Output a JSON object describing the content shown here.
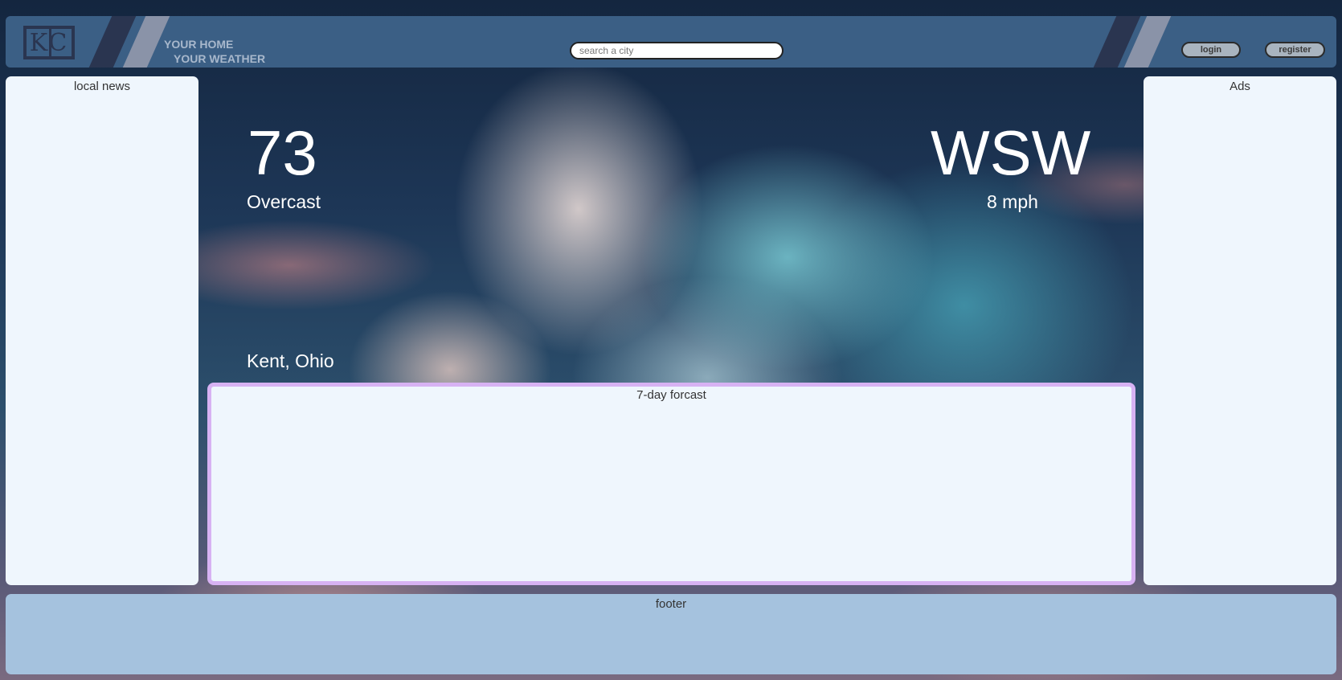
{
  "header": {
    "logo_text": "KC",
    "tagline_line1": "YOUR HOME",
    "tagline_line2": "YOUR WEATHER",
    "search_placeholder": "search a city",
    "login_label": "login",
    "register_label": "register"
  },
  "left_panel": {
    "title": "local news"
  },
  "right_panel": {
    "title": "Ads"
  },
  "weather": {
    "temperature": "73",
    "condition": "Overcast",
    "wind_direction": "WSW",
    "wind_speed": "8 mph",
    "location": "Kent, Ohio"
  },
  "forecast": {
    "title": "7-day forcast"
  },
  "footer": {
    "label": "footer"
  },
  "colors": {
    "header_bg": "#3b5f85",
    "panel_bg": "#eff6fd",
    "forecast_border": "#d7b2f3",
    "footer_bg": "#a5c2de"
  }
}
